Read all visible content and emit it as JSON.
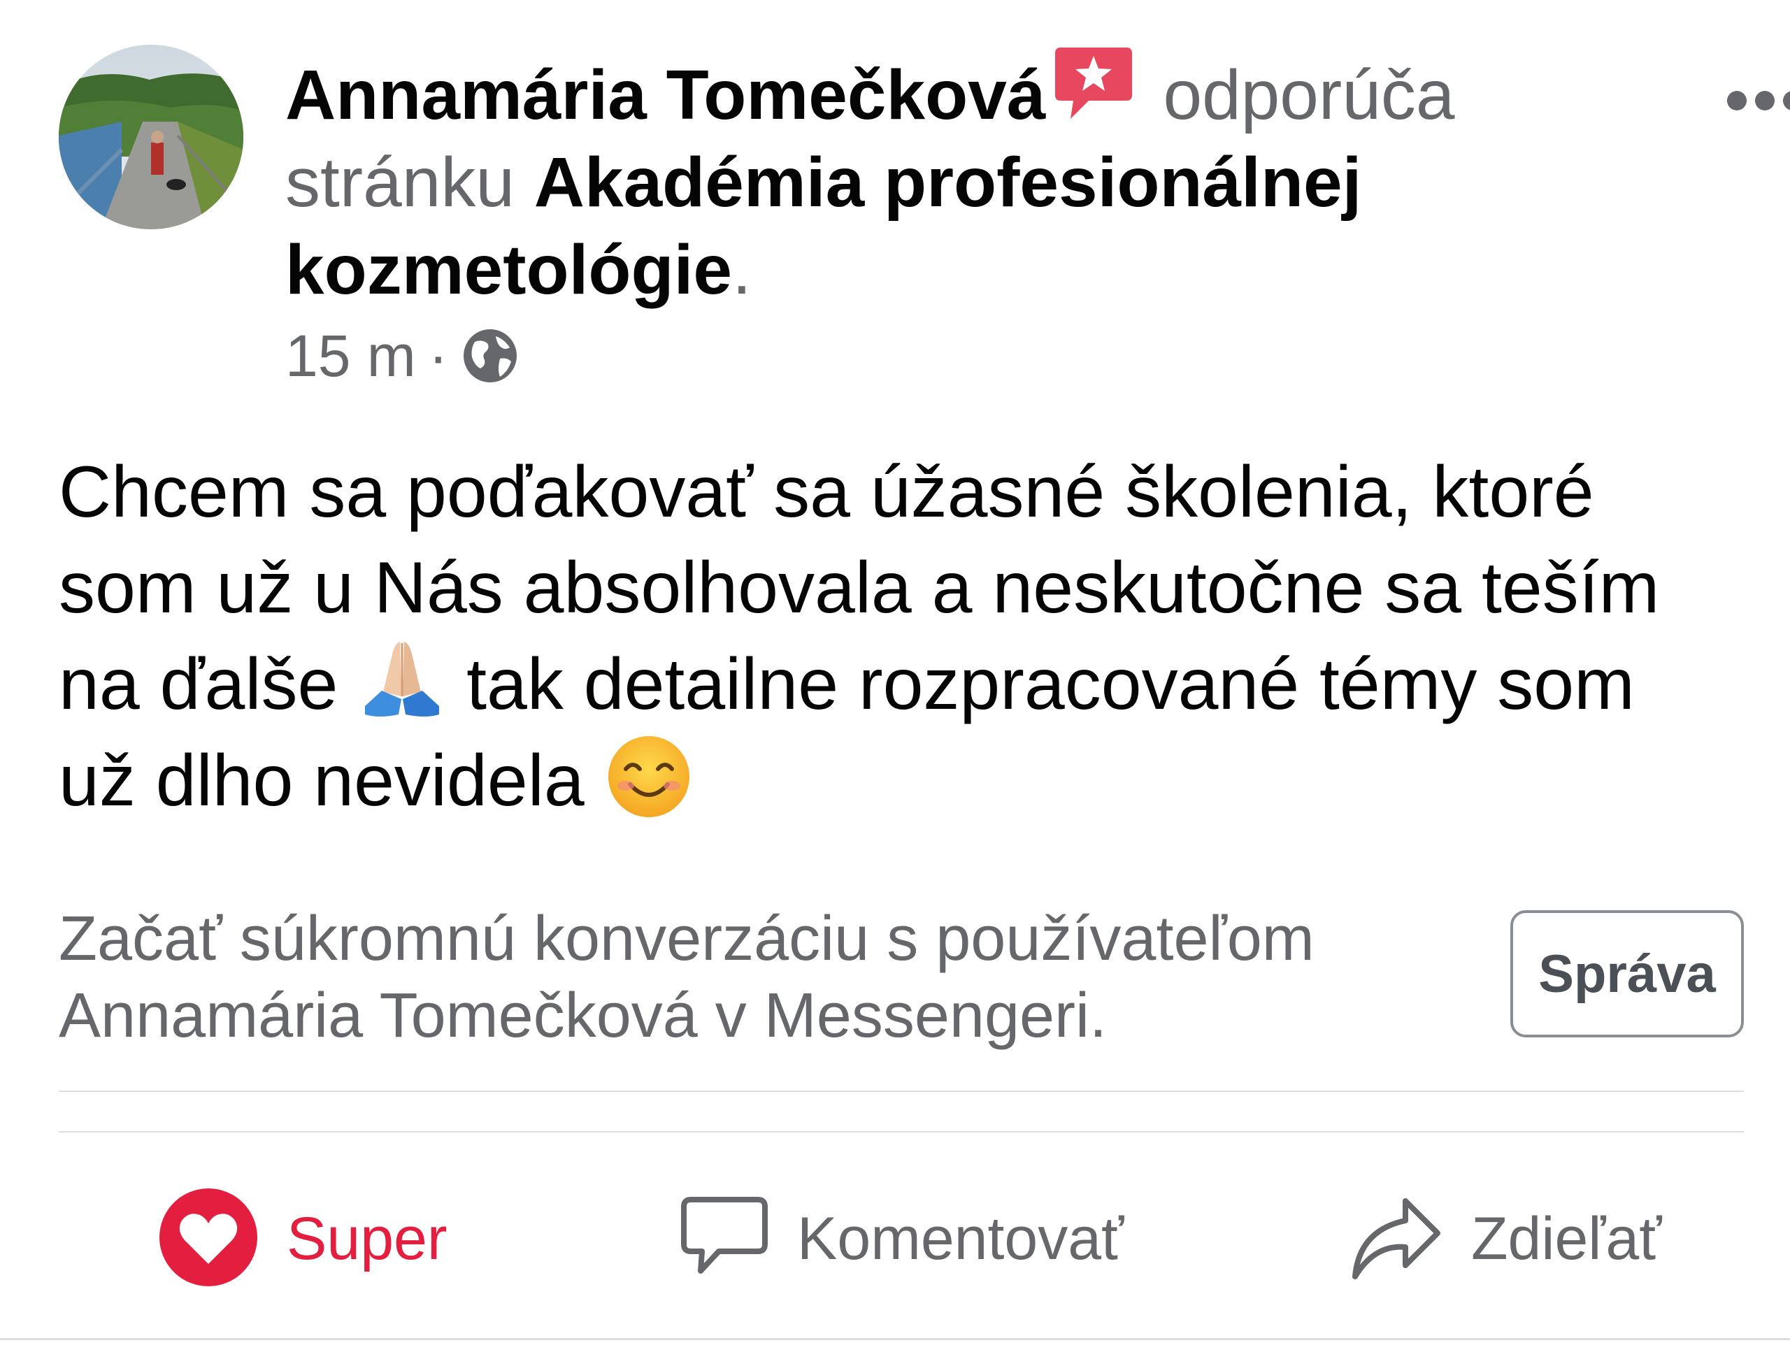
{
  "post": {
    "author_name": "Annamária Tomečková",
    "recommends_text": "odporúča",
    "page_prefix": "stránku",
    "page_name_line1": "Akadémia profesionálnej",
    "page_name_line2": "kozmetológie",
    "page_suffix": ".",
    "time": "15 m",
    "separator": "·",
    "privacy_icon": "globe-icon",
    "more_icon": "more-dots-icon",
    "badge_icon": "recommendation-star-icon",
    "badge_color": "#e8485f",
    "body": {
      "line1": "Chcem sa poďakovať sa úžasné školenia, ktoré",
      "line2": "som už u Nás absolhovala a neskutočne sa teším",
      "line3_a": "na ďalše",
      "line3_b": "tak detailne rozpracované témy som",
      "line4": "už dlho nevidela",
      "emoji1": "folded-hands-emoji",
      "emoji2": "smiling-face-emoji"
    }
  },
  "messenger_cta": {
    "text_line1": "Začať súkromnú konverzáciu s používateľom",
    "text_line2": "Annamária Tomečková v Messengeri.",
    "button_label": "Správa"
  },
  "actions": {
    "like": {
      "label": "Super",
      "icon": "heart-icon",
      "color": "#e41e3f"
    },
    "comment": {
      "label": "Komentovať",
      "icon": "comment-icon",
      "color": "#65676b"
    },
    "share": {
      "label": "Zdieľať",
      "icon": "share-icon",
      "color": "#65676b"
    }
  }
}
